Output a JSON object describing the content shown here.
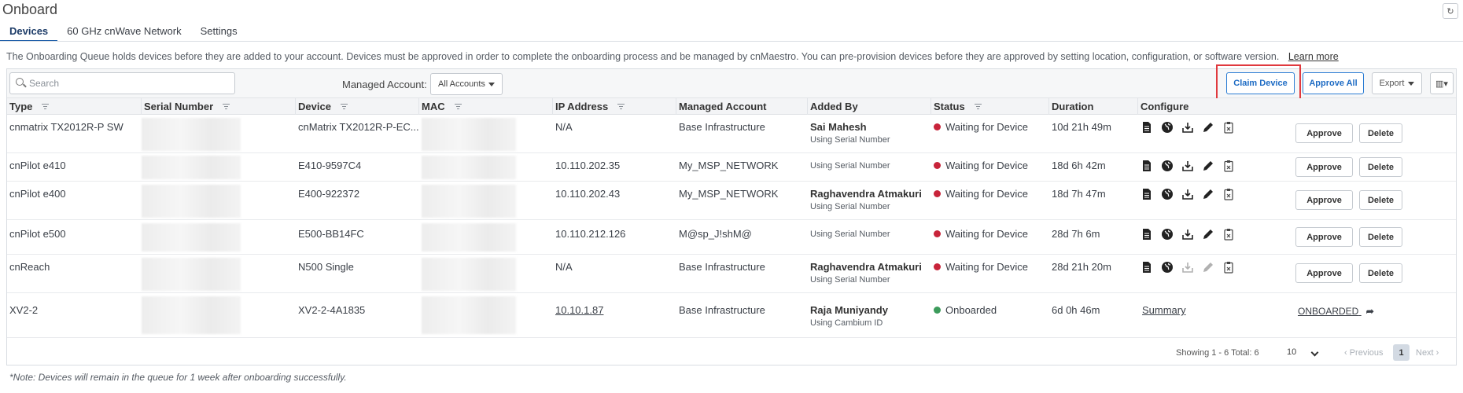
{
  "page": {
    "title": "Onboard",
    "refresh_icon": "refresh-icon"
  },
  "tabs": [
    {
      "label": "Devices",
      "active": true
    },
    {
      "label": "60 GHz cnWave Network",
      "active": false
    },
    {
      "label": "Settings",
      "active": false
    }
  ],
  "intro": {
    "text": "The Onboarding Queue holds devices before they are added to your account. Devices must be approved in order to complete the onboarding process and be managed by cnMaestro. You can pre-provision devices before they are approved by setting location, configuration, or software version.",
    "learn_more": "Learn more"
  },
  "toolbar": {
    "search_placeholder": "Search",
    "managed_account_label": "Managed Account:",
    "managed_account_value": "All Accounts",
    "claim_device": "Claim Device",
    "approve_all": "Approve All",
    "export": "Export"
  },
  "columns": {
    "type": "Type",
    "serial": "Serial Number",
    "device": "Device",
    "mac": "MAC",
    "ip": "IP Address",
    "account": "Managed Account",
    "added_by": "Added By",
    "status": "Status",
    "duration": "Duration",
    "configure": "Configure"
  },
  "rows": [
    {
      "type": "cnmatrix TX2012R-P SW",
      "device": "cnMatrix TX2012R-P-EC...",
      "ip": "N/A",
      "account": "Base Infrastructure",
      "added_by": "Sai Mahesh",
      "added_via": "Using Serial Number",
      "status": "Waiting for Device",
      "duration": "10d 21h 49m",
      "approve": "Approve",
      "delete": "Delete"
    },
    {
      "type": "cnPilot e410",
      "device": "E410-9597C4",
      "ip": "10.110.202.35",
      "account": "My_MSP_NETWORK",
      "added_by": "",
      "added_via": "Using Serial Number",
      "status": "Waiting for Device",
      "duration": "18d 6h 42m",
      "approve": "Approve",
      "delete": "Delete"
    },
    {
      "type": "cnPilot e400",
      "device": "E400-922372",
      "ip": "10.110.202.43",
      "account": "My_MSP_NETWORK",
      "added_by": "Raghavendra Atmakuri",
      "added_via": "Using Serial Number",
      "status": "Waiting for Device",
      "duration": "18d 7h 47m",
      "approve": "Approve",
      "delete": "Delete"
    },
    {
      "type": "cnPilot e500",
      "device": "E500-BB14FC",
      "ip": "10.110.212.126",
      "account": "M@sp_J!shM@",
      "added_by": "",
      "added_via": "Using Serial Number",
      "status": "Waiting for Device",
      "duration": "28d 7h 6m",
      "approve": "Approve",
      "delete": "Delete"
    },
    {
      "type": "cnReach",
      "device": "N500 Single",
      "ip": "N/A",
      "account": "Base Infrastructure",
      "added_by": "Raghavendra Atmakuri",
      "added_via": "Using Serial Number",
      "status": "Waiting for Device",
      "duration": "28d 21h 20m",
      "approve": "Approve",
      "delete": "Delete"
    },
    {
      "type": "XV2-2",
      "device": "XV2-2-4A1835",
      "ip": "10.10.1.87",
      "account": "Base Infrastructure",
      "added_by": "Raja Muniyandy",
      "added_via": "Using Cambium ID",
      "status": "Onboarded",
      "duration": "6d 0h 46m",
      "configure_link": "Summary",
      "onboarded": "ONBOARDED"
    }
  ],
  "status_colors": {
    "waiting": "#c8243a",
    "onboarded": "#3c9b5b"
  },
  "accent": "#2b7cd3",
  "highlight_color": "#e0393e",
  "pagination": {
    "info": "Showing 1 - 6 Total: 6",
    "page_size": "10",
    "previous": "‹ Previous",
    "current_page": "1",
    "next": "Next ›"
  },
  "note": "*Note: Devices will remain in the queue for 1 week after onboarding successfully."
}
